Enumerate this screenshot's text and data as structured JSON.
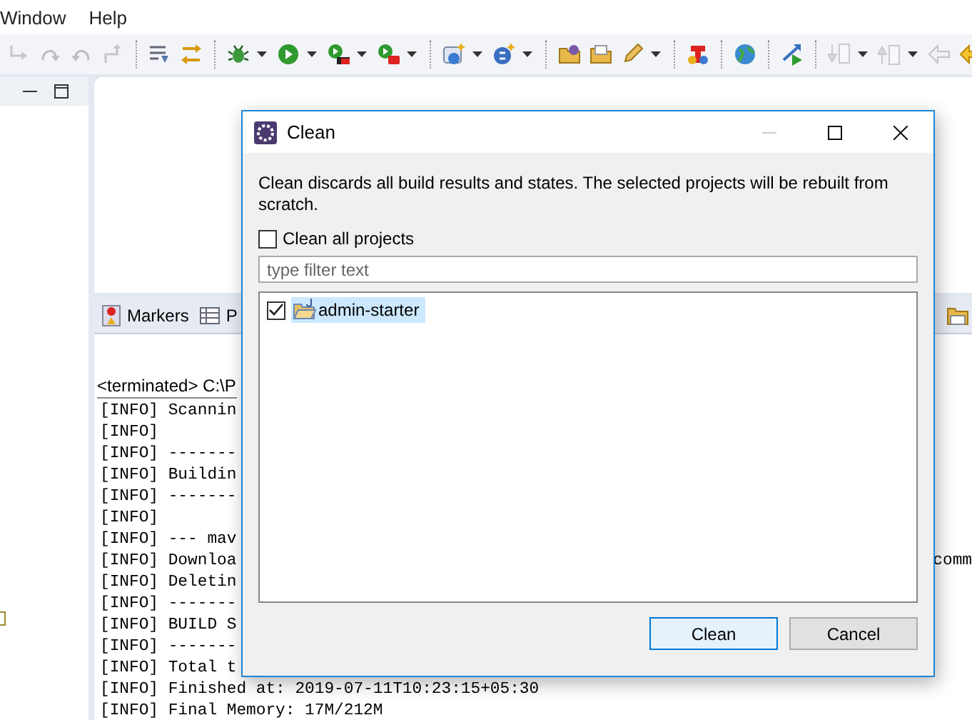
{
  "menu": [
    {
      "label": "Window"
    },
    {
      "label": "Help"
    }
  ],
  "toolbar": {
    "groups": [
      {
        "items": [
          {
            "disabled": true,
            "dropdown": false
          },
          {
            "disabled": true,
            "dropdown": false
          },
          {
            "disabled": true,
            "dropdown": false
          },
          {
            "disabled": true,
            "dropdown": false
          }
        ]
      },
      {
        "items": [
          {
            "disabled": false,
            "dropdown": false
          },
          {
            "disabled": false,
            "dropdown": false
          }
        ]
      },
      {
        "items": [
          {
            "disabled": false,
            "dropdown": true
          },
          {
            "disabled": false,
            "dropdown": true
          },
          {
            "disabled": false,
            "dropdown": true
          },
          {
            "disabled": false,
            "dropdown": true
          }
        ]
      },
      {
        "items": [
          {
            "disabled": false,
            "dropdown": true
          },
          {
            "disabled": false,
            "dropdown": true
          }
        ]
      },
      {
        "items": [
          {
            "disabled": false,
            "dropdown": false
          },
          {
            "disabled": false,
            "dropdown": false
          },
          {
            "disabled": false,
            "dropdown": true
          }
        ]
      },
      {
        "items": [
          {
            "disabled": false,
            "dropdown": false
          }
        ]
      },
      {
        "items": [
          {
            "disabled": false,
            "dropdown": false
          }
        ]
      },
      {
        "items": [
          {
            "disabled": false,
            "dropdown": false
          }
        ]
      },
      {
        "items": [
          {
            "disabled": true,
            "dropdown": true
          },
          {
            "disabled": true,
            "dropdown": true
          },
          {
            "disabled": true,
            "dropdown": false
          },
          {
            "disabled": false,
            "dropdown": false
          }
        ]
      }
    ]
  },
  "console": {
    "tabs": [
      {
        "label": "Markers"
      },
      {
        "label": "P"
      }
    ],
    "header": "<terminated> C:\\P",
    "lines": [
      {
        "text": "[INFO] Scannin"
      },
      {
        "text": "[INFO]"
      },
      {
        "text": "[INFO] -------"
      },
      {
        "text": "[INFO] Buildin"
      },
      {
        "text": "[INFO] -------"
      },
      {
        "text": "[INFO]"
      },
      {
        "text": "[INFO] --- mav"
      },
      {
        "text": "[INFO] Downloa",
        "trailing": "comm"
      },
      {
        "text": "[INFO] Deletin"
      },
      {
        "text": "[INFO] -------"
      },
      {
        "text": "[INFO] BUILD S"
      },
      {
        "text": "[INFO] -------"
      },
      {
        "text": "[INFO] Total t"
      },
      {
        "text": "[INFO] Finished at: 2019-07-11T10:23:15+05:30"
      },
      {
        "text": "[INFO] Final Memory: 17M/212M"
      }
    ]
  },
  "dialog": {
    "title": "Clean",
    "minimize_disabled": true,
    "description": "Clean discards all build results and states. The selected projects will be rebuilt from scratch.",
    "clean_all": {
      "label": "Clean all projects",
      "checked": false
    },
    "filter": {
      "placeholder": "type filter text"
    },
    "projects": [
      {
        "label": "admin-starter",
        "checked": true,
        "selected": true
      }
    ],
    "buttons": [
      {
        "label": "Clean",
        "default": true
      },
      {
        "label": "Cancel",
        "default": false
      }
    ]
  }
}
